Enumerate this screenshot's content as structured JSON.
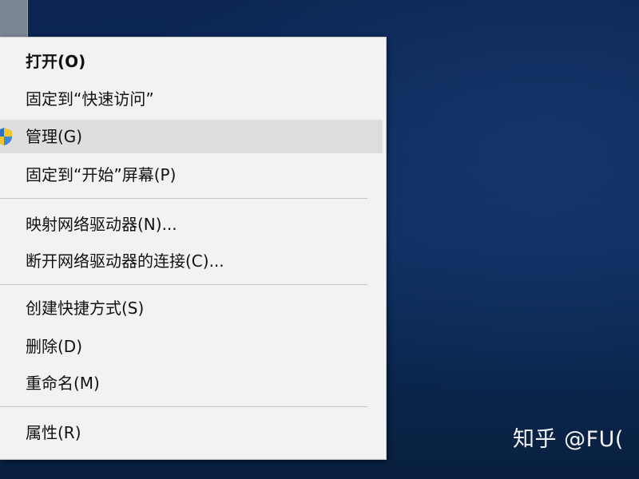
{
  "context_menu": {
    "items": [
      {
        "label": "打开(O)"
      },
      {
        "label": "固定到“快速访问”"
      },
      {
        "label": "管理(G)",
        "icon": "admin-shield-icon"
      },
      {
        "label": "固定到“开始”屏幕(P)"
      },
      {
        "label": "映射网络驱动器(N)..."
      },
      {
        "label": "断开网络驱动器的连接(C)..."
      },
      {
        "label": "创建快捷方式(S)"
      },
      {
        "label": "删除(D)"
      },
      {
        "label": "重命名(M)"
      },
      {
        "label": "属性(R)"
      }
    ],
    "highlighted_item": "管理(G)"
  },
  "watermark": {
    "text": "知乎 @FU("
  },
  "colors": {
    "desktop_background": "#0b2a5a",
    "menu_background": "#f2f2f2",
    "highlight": "#dedede",
    "separator": "#c4c4c4"
  }
}
